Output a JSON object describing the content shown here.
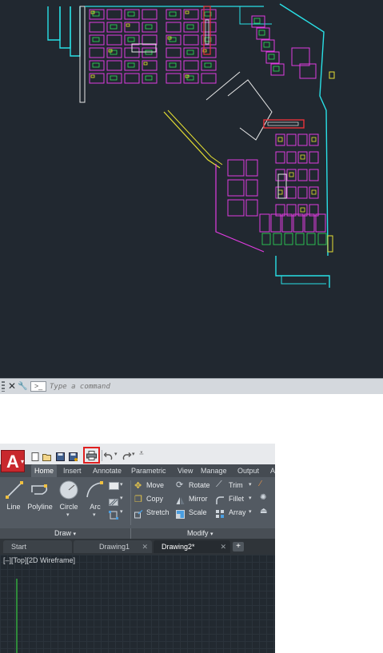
{
  "command_line": {
    "close_icon": "✕",
    "wrench_icon": "🔧",
    "prompt_glyph": ">_",
    "placeholder": "Type a command"
  },
  "quick_access": {
    "app_logo": "A",
    "tools": [
      "new-icon",
      "open-icon",
      "save-icon",
      "saveas-icon",
      "plot-icon",
      "undo-icon",
      "redo-icon",
      "customize-icon"
    ]
  },
  "ribbon_tabs": [
    "Home",
    "Insert",
    "Annotate",
    "Parametric",
    "View",
    "Manage",
    "Output",
    "A"
  ],
  "draw_panel": {
    "tools": [
      "Line",
      "Polyline",
      "Circle",
      "Arc"
    ],
    "title": "Draw"
  },
  "modify_panel": {
    "col1": [
      "Move",
      "Copy",
      "Stretch"
    ],
    "col2": [
      "Rotate",
      "Mirror",
      "Scale"
    ],
    "col3": [
      "Trim",
      "Fillet",
      "Array"
    ],
    "title": "Modify"
  },
  "file_tabs": [
    {
      "label": "Start"
    },
    {
      "label": "Drawing1"
    },
    {
      "label": "Drawing2*"
    }
  ],
  "viewport_label": "[–][Top][2D Wireframe]",
  "colors": {
    "cad_bg": "#212830",
    "highlight": "#e02020",
    "layer_cyan": "#29e0e6",
    "layer_magenta": "#e03ce0",
    "layer_green": "#2ee05a",
    "layer_yellow": "#e6e033",
    "layer_red": "#e8323a",
    "layer_white": "#e8e8e8"
  }
}
